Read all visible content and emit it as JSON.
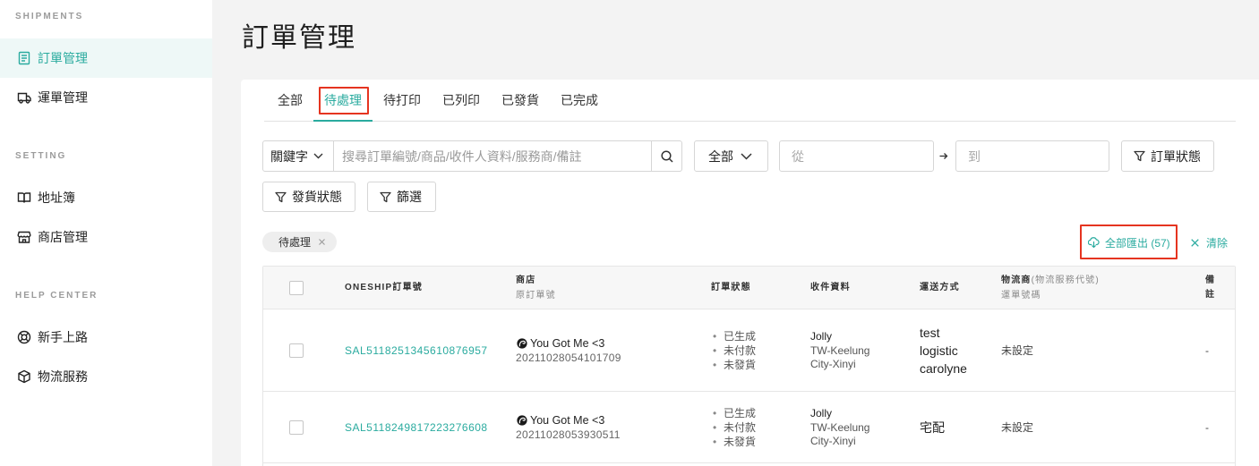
{
  "sidebar": {
    "sections": [
      {
        "title": "SHIPMENTS",
        "items": [
          {
            "label": "訂單管理",
            "icon": "document-icon",
            "active": true
          },
          {
            "label": "運單管理",
            "icon": "truck-icon"
          }
        ]
      },
      {
        "title": "SETTING",
        "items": [
          {
            "label": "地址簿",
            "icon": "book-icon"
          },
          {
            "label": "商店管理",
            "icon": "store-icon"
          }
        ]
      },
      {
        "title": "HELP CENTER",
        "items": [
          {
            "label": "新手上路",
            "icon": "lifebuoy-icon"
          },
          {
            "label": "物流服務",
            "icon": "box-icon"
          }
        ]
      }
    ]
  },
  "page": {
    "title": "訂單管理"
  },
  "tabs": [
    {
      "label": "全部"
    },
    {
      "label": "待處理",
      "active": true
    },
    {
      "label": "待打印"
    },
    {
      "label": "已列印"
    },
    {
      "label": "已發貨"
    },
    {
      "label": "已完成"
    }
  ],
  "filters": {
    "keyword_select": {
      "value": "關鍵字",
      "icon": "chevron-down-icon"
    },
    "search": {
      "placeholder": "搜尋訂單編號/商品/收件人資料/服務商/備註",
      "value": "",
      "icon": "search-icon"
    },
    "scope_select": {
      "value": "全部",
      "icon": "chevron-down-icon"
    },
    "date_from": {
      "placeholder": "從"
    },
    "date_to": {
      "placeholder": "到"
    },
    "order_status_button": "訂單狀態",
    "shipping_status_button": "發貨狀態",
    "filter_button": "篩選"
  },
  "active_filters": [
    {
      "label": "待處理"
    }
  ],
  "actions": {
    "export_label": "全部匯出 (57)",
    "export_icon": "cloud-download-icon",
    "clear_label": "清除"
  },
  "table": {
    "columns": {
      "order_no": "ONESHIP訂單號",
      "shop": "商店",
      "original_order_no": "原訂單號",
      "order_status": "訂單狀態",
      "recipient": "收件資料",
      "shipping_method": "運送方式",
      "carrier": "物流商",
      "carrier_code": "(物流服務代號)",
      "tracking_no": "運單號碼",
      "note": "備註"
    },
    "rows": [
      {
        "order_no": "SAL5118251345610876957",
        "shop_name": "You Got Me <3",
        "original_order_no": "20211028054101709",
        "statuses": [
          "已生成",
          "未付款",
          "未發貨"
        ],
        "recipient_name": "Jolly",
        "recipient_address": "TW-Keelung City-Xinyi",
        "shipping_method": "test logistic carolyne",
        "carrier": "未設定",
        "note": "-"
      },
      {
        "order_no": "SAL5118249817223276608",
        "shop_name": "You Got Me <3",
        "original_order_no": "20211028053930511",
        "statuses": [
          "已生成",
          "未付款",
          "未發貨"
        ],
        "recipient_name": "Jolly",
        "recipient_address": "TW-Keelung City-Xinyi",
        "shipping_method": "宅配",
        "carrier": "未設定",
        "note": "-"
      }
    ]
  },
  "colors": {
    "accent": "#2aab9f",
    "highlight": "#e53420",
    "background": "#f3f3f3"
  }
}
